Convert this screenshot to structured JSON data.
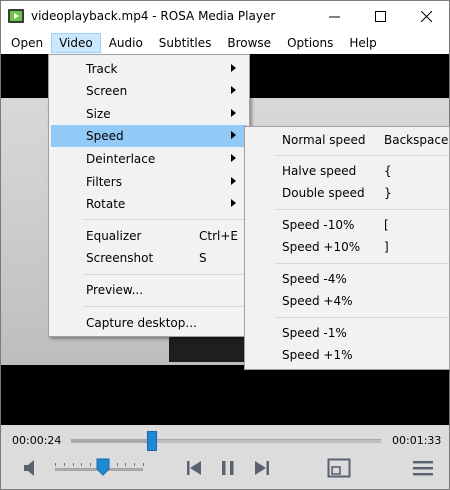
{
  "window": {
    "title": "videoplayback.mp4 - ROSA Media Player",
    "controls": [
      "minimize-icon",
      "maximize-icon",
      "close-icon"
    ]
  },
  "menubar": {
    "items": [
      {
        "label": "Open"
      },
      {
        "label": "Video",
        "active": true
      },
      {
        "label": "Audio"
      },
      {
        "label": "Subtitles"
      },
      {
        "label": "Browse"
      },
      {
        "label": "Options"
      },
      {
        "label": "Help"
      }
    ]
  },
  "video_menu": {
    "items": [
      {
        "label": "Track",
        "submenu": true
      },
      {
        "label": "Screen",
        "submenu": true
      },
      {
        "label": "Size",
        "submenu": true
      },
      {
        "label": "Speed",
        "submenu": true,
        "highlighted": true
      },
      {
        "label": "Deinterlace",
        "submenu": true
      },
      {
        "label": "Filters",
        "submenu": true
      },
      {
        "label": "Rotate",
        "submenu": true
      },
      {
        "label": "Equalizer",
        "shortcut": "Ctrl+E"
      },
      {
        "label": "Screenshot",
        "shortcut": "S"
      },
      {
        "label": "Preview..."
      },
      {
        "label": "Capture desktop..."
      }
    ]
  },
  "speed_submenu": {
    "items": [
      {
        "label": "Normal speed",
        "shortcut": "Backspace"
      },
      {
        "label": "Halve speed",
        "shortcut": "{"
      },
      {
        "label": "Double speed",
        "shortcut": "}"
      },
      {
        "label": "Speed -10%",
        "shortcut": "["
      },
      {
        "label": "Speed +10%",
        "shortcut": "]"
      },
      {
        "label": "Speed -4%",
        "shortcut": ""
      },
      {
        "label": "Speed +4%",
        "shortcut": ""
      },
      {
        "label": "Speed -1%",
        "shortcut": ""
      },
      {
        "label": "Speed +1%",
        "shortcut": ""
      }
    ]
  },
  "playback": {
    "elapsed": "00:00:24",
    "duration": "00:01:33",
    "position_fraction": 0.26,
    "volume_fraction": 0.55
  },
  "toolbar_icons": [
    "speaker-icon",
    "previous-icon",
    "pause-icon",
    "next-icon",
    "fullscreen-icon",
    "menu-icon"
  ],
  "colors": {
    "accent": "#1e8ad6",
    "menu_highlight": "#91c9f7",
    "menubar_active": "#cce8ff",
    "control_bg": "#dcdcdc"
  }
}
